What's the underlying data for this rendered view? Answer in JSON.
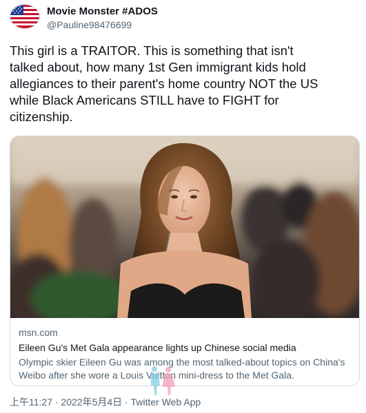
{
  "tweet": {
    "user": {
      "display_name": "Movie Monster #ADOS",
      "handle": "@Pauline98476699",
      "avatar_icon": "us-flag-avatar-icon"
    },
    "text_lines": [
      "This girl is a TRAITOR. This is something that isn't",
      "talked about, how many 1st Gen immigrant kids hold",
      "allegiances to their parent's home country NOT the US",
      "while Black Americans STILL have to FIGHT for",
      "citizenship."
    ],
    "link_card": {
      "domain": "msn.com",
      "title": "Eileen Gu's Met Gala appearance lights up Chinese social media",
      "description_lines": [
        "Olympic skier Eileen Gu was among the most talked-about topics on China's",
        "Weibo after she wore a Louis Vuitton mini-dress to the Met Gala."
      ]
    },
    "timestamp": "上午11:27 · 2022年5月4日 · Twitter Web App"
  },
  "colors": {
    "text_primary": "#0f1419",
    "text_secondary": "#536471",
    "card_border": "#cfd9de"
  }
}
